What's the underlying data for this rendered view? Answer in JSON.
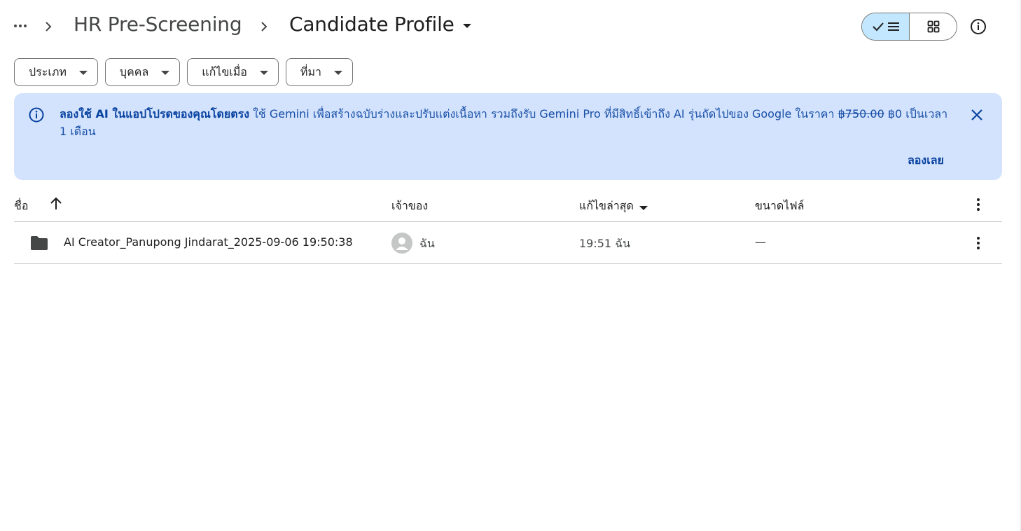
{
  "breadcrumb": {
    "parent": "HR Pre-Screening",
    "current": "Candidate Profile"
  },
  "view_toggle": {
    "active": "list",
    "options": [
      "list",
      "grid"
    ]
  },
  "filters": [
    {
      "label": "ประเภท"
    },
    {
      "label": "บุคคล"
    },
    {
      "label": "แก้ไขเมื่อ"
    },
    {
      "label": "ที่มา"
    }
  ],
  "banner": {
    "title": "ลองใช้ AI ในแอปโปรดของคุณโดยตรง",
    "body_1": " ใช้ Gemini เพื่อสร้างฉบับร่างและปรับแต่งเนื้อหา รวมถึงรับ Gemini Pro ที่มีสิทธิ์เข้าถึง AI รุ่นถัดไปของ Google ในราคา ",
    "old_price": "฿750.00",
    "body_2": " ฿0 เป็นเวลา 1 เดือน",
    "action": "ลองเลย"
  },
  "table": {
    "columns": {
      "name": "ชื่อ",
      "owner": "เจ้าของ",
      "modified": "แก้ไขล่าสุด",
      "size": "ขนาดไฟล์"
    },
    "rows": [
      {
        "name": "AI Creator_Panupong Jindarat_2025-09-06 19:50:38",
        "owner": "ฉัน",
        "modified": "19:51 ฉัน",
        "size": "—"
      }
    ]
  },
  "colors": {
    "banner_bg": "#d3e3fd",
    "toggle_active": "#c2e7ff",
    "accent_text": "#0842a0"
  }
}
